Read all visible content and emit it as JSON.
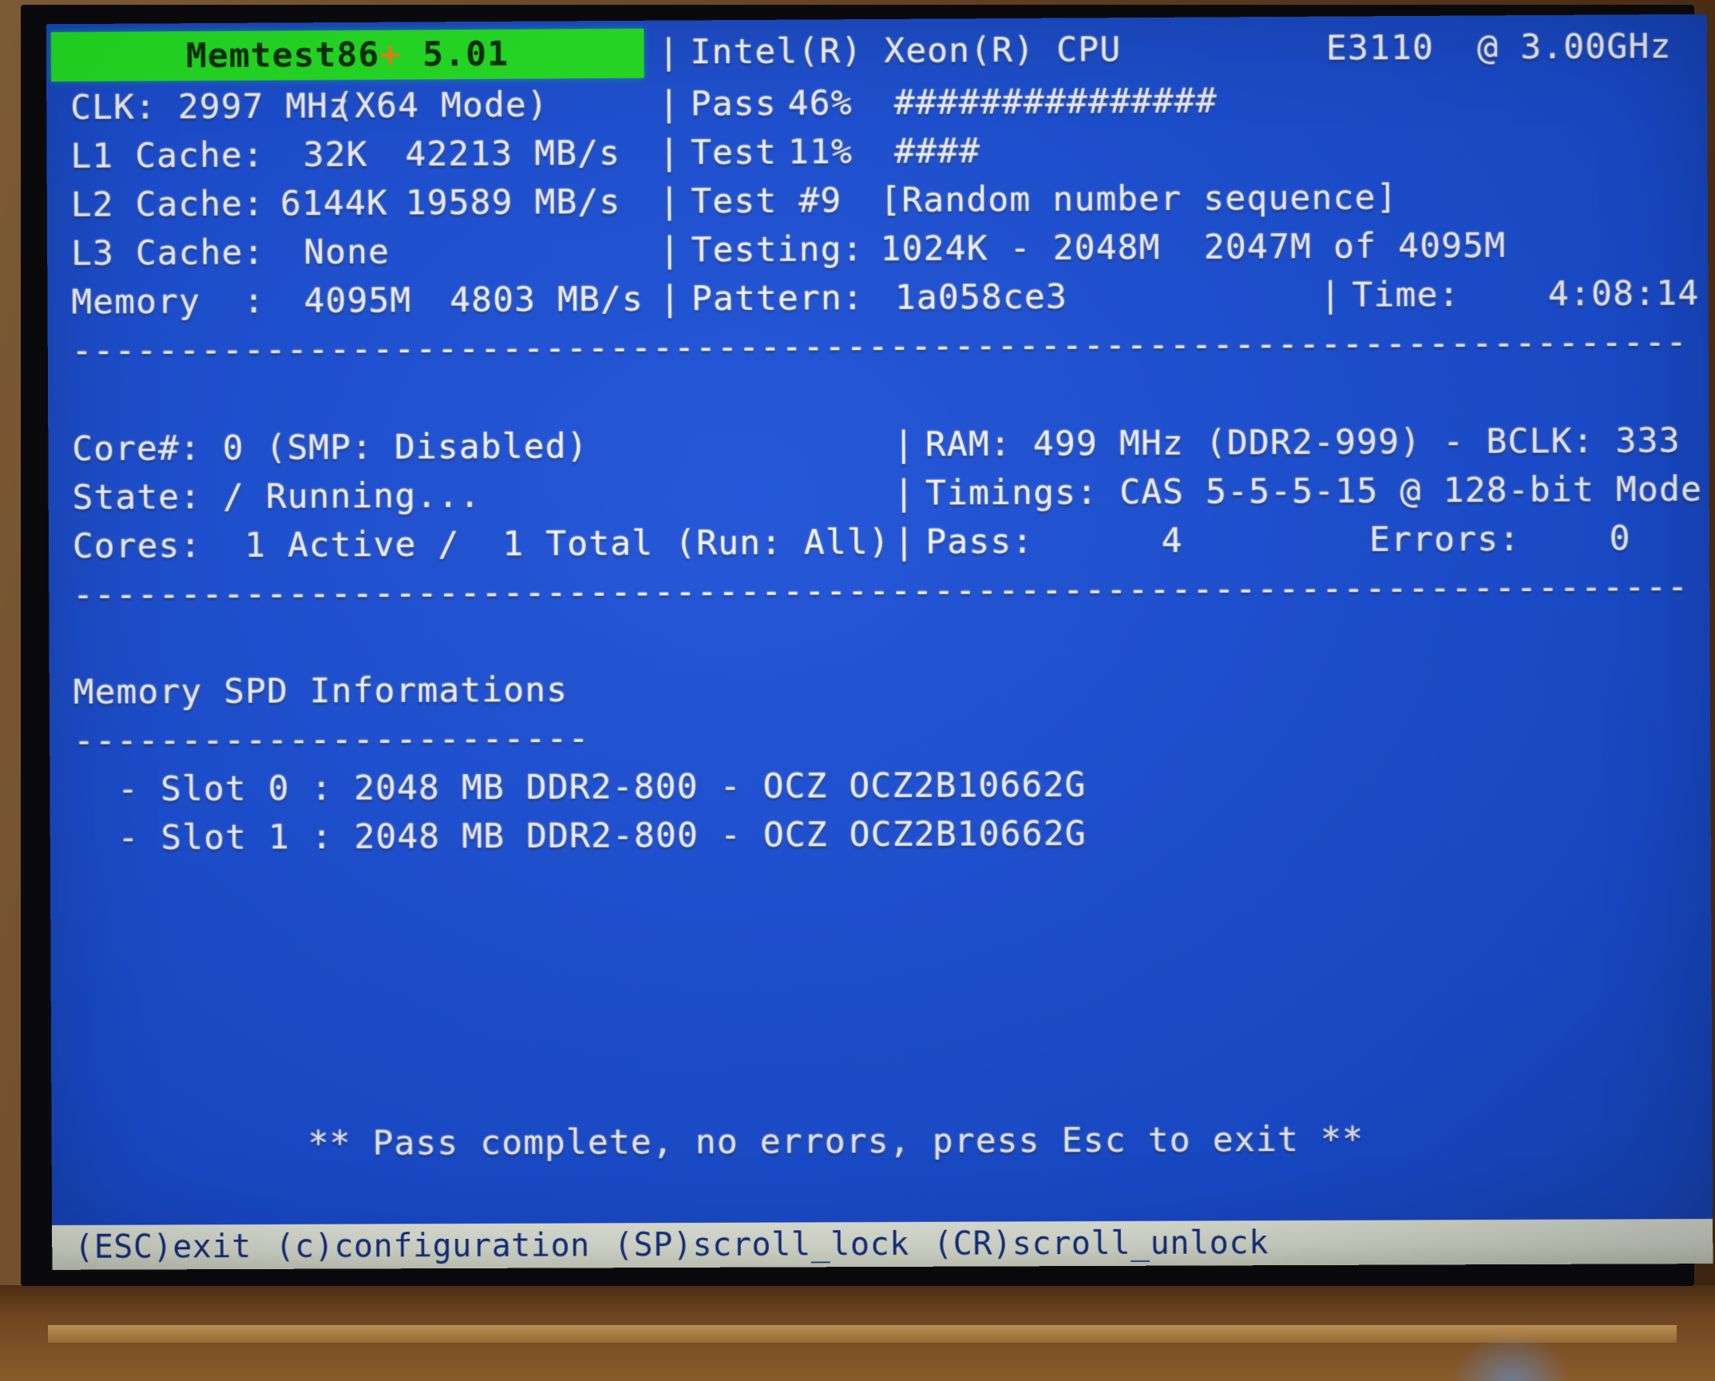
{
  "app": {
    "title_prefix": "Memtest86",
    "title_plus": "+",
    "title_version": " 5.01"
  },
  "sysinfo": {
    "clk_label": "CLK: 2997 MHz",
    "clk_mode": "(X64 Mode)",
    "l1_label": "L1 Cache:",
    "l1_size": "32K",
    "l1_speed": "42213 MB/s",
    "l2_label": "L2 Cache:",
    "l2_size": "6144K",
    "l2_speed": "19589 MB/s",
    "l3_label": "L3 Cache:",
    "l3_size": "None",
    "l3_speed": "",
    "mem_label": "Memory  :",
    "mem_size": "4095M",
    "mem_speed": "4803 MB/s"
  },
  "testinfo": {
    "cpu_model": "Intel(R) Xeon(R) CPU",
    "cpu_sku": "E3110  @ 3.00GHz",
    "pass_label": "Pass",
    "pass_percent": "46%",
    "pass_bar": "###############",
    "test_label": "Test",
    "test_percent": "11%",
    "test_bar": "####",
    "test_num_label": "Test #9",
    "test_name": "[Random number sequence]",
    "testing_label": "Testing:",
    "testing_range": "1024K - 2048M",
    "testing_progress": "2047M of 4095M",
    "pattern_label": "Pattern:",
    "pattern_value": "1a058ce3",
    "time_label": "Time:",
    "time_value": "4:08:14"
  },
  "status": {
    "core_label": "Core#: 0 (SMP: Disabled)",
    "state_label": "State: / Running...",
    "cores_label": "Cores:  1 Active /  1 Total (Run: All)",
    "ram_label": "RAM: 499 MHz (DDR2-999) - BCLK: 333",
    "timings_label": "Timings: CAS 5-5-5-15 @ 128-bit Mode",
    "pass_count_label": "Pass:",
    "pass_count_value": "4",
    "errors_label": "Errors:",
    "errors_value": "0"
  },
  "spd": {
    "heading": "Memory SPD Informations",
    "underline": "------------------------",
    "slots": [
      "- Slot 0 : 2048 MB DDR2-800 - OCZ OCZ2B10662G",
      "- Slot 1 : 2048 MB DDR2-800 - OCZ OCZ2B10662G"
    ]
  },
  "message": {
    "pass_complete": "** Pass complete, no errors, press Esc to exit **"
  },
  "separators": {
    "line": "---------------------------------------------------------------------------"
  },
  "keybar": {
    "k1": "(ESC)exit",
    "k2": "(c)configuration",
    "k3": "(SP)scroll_lock",
    "k4": "(CR)scroll_unlock"
  },
  "colors": {
    "screen_blue": "#1a4fd6",
    "banner_green": "#22e022",
    "plus_orange": "#e08a10",
    "text_white": "#f2f4ff",
    "keybar_bg": "#e2e7d8",
    "keybar_text": "#13307f"
  }
}
